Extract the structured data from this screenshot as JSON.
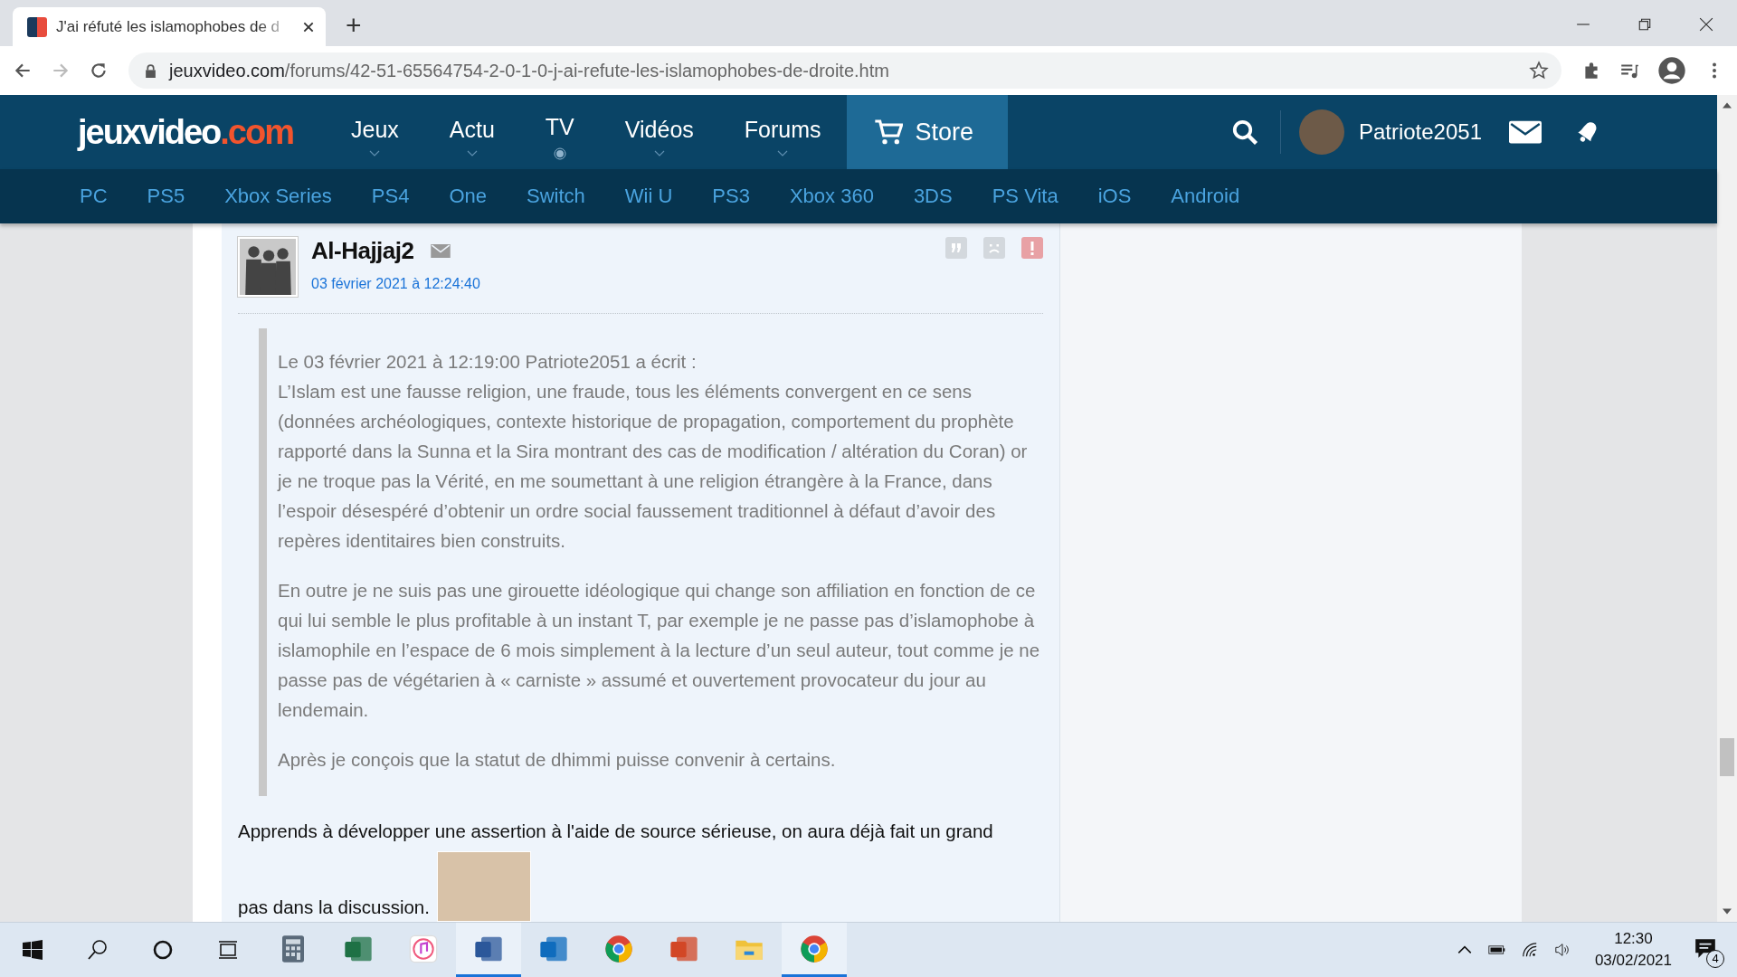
{
  "browser": {
    "tab_title": "J'ai réfuté les islamophobes de d",
    "new_tab": "+",
    "url_host": "jeuxvideo.com",
    "url_path": "/forums/42-51-65564754-2-0-1-0-j-ai-refute-les-islamophobes-de-droite.htm"
  },
  "site": {
    "logo_main": "jeuxvideo",
    "logo_suffix": ".com",
    "nav": [
      {
        "label": "Jeux",
        "kind": "dropdown"
      },
      {
        "label": "Actu",
        "kind": "dropdown"
      },
      {
        "label": "TV",
        "kind": "live"
      },
      {
        "label": "Vidéos",
        "kind": "dropdown"
      },
      {
        "label": "Forums",
        "kind": "dropdown"
      }
    ],
    "store": {
      "label": "Store",
      "selected": true
    },
    "username": "Patriote2051",
    "platforms": [
      "PC",
      "PS5",
      "Xbox Series",
      "PS4",
      "One",
      "Switch",
      "Wii U",
      "PS3",
      "Xbox 360",
      "3DS",
      "PS Vita",
      "iOS",
      "Android"
    ]
  },
  "post": {
    "author": "Al-Hajjaj2",
    "date": "03 février 2021 à 12:24:40",
    "quote": {
      "header": "Le 03 février 2021 à 12:19:00 Patriote2051 a écrit :",
      "paragraphs": [
        "L’Islam est une fausse religion, une fraude, tous les éléments convergent en ce sens (données archéologiques, contexte historique de propagation, comportement du prophète rapporté dans la Sunna et la Sira montrant des cas de modification / altération du Coran) or je ne troque pas la Vérité, en me soumettant à une religion étrangère à la France, dans l’espoir désespéré d’obtenir un ordre social faussement traditionnel à défaut d’avoir des repères identitaires bien construits.",
        "En outre je ne suis pas une girouette idéologique qui change son affiliation en fonction de ce qui lui semble le plus profitable à un instant T, par exemple je ne passe pas d’islamophobe à islamophile en l’espace de 6 mois simplement à la lecture d’un seul auteur, tout comme je ne passe pas de végétarien à « carniste » assumé et ouvertement provocateur du jour au lendemain.",
        "Après je conçois que la statut de dhimmi puisse convenir à certains."
      ]
    },
    "reply_line_1": "Apprends à développer une assertion à l'aide de source sérieuse, on aura déjà fait un grand",
    "reply_line_2": "pas dans la discussion."
  },
  "taskbar": {
    "apps": [
      {
        "kind": "calculator",
        "active": false
      },
      {
        "kind": "excel",
        "active": false
      },
      {
        "kind": "music",
        "active": false
      },
      {
        "kind": "word",
        "active": true
      },
      {
        "kind": "outlook",
        "active": false
      },
      {
        "kind": "chrome",
        "active": false
      },
      {
        "kind": "powerpoint",
        "active": false
      },
      {
        "kind": "explorer",
        "active": false
      },
      {
        "kind": "chrome",
        "active": true
      }
    ],
    "time": "12:30",
    "date": "03/02/2021",
    "notifications": "4"
  }
}
